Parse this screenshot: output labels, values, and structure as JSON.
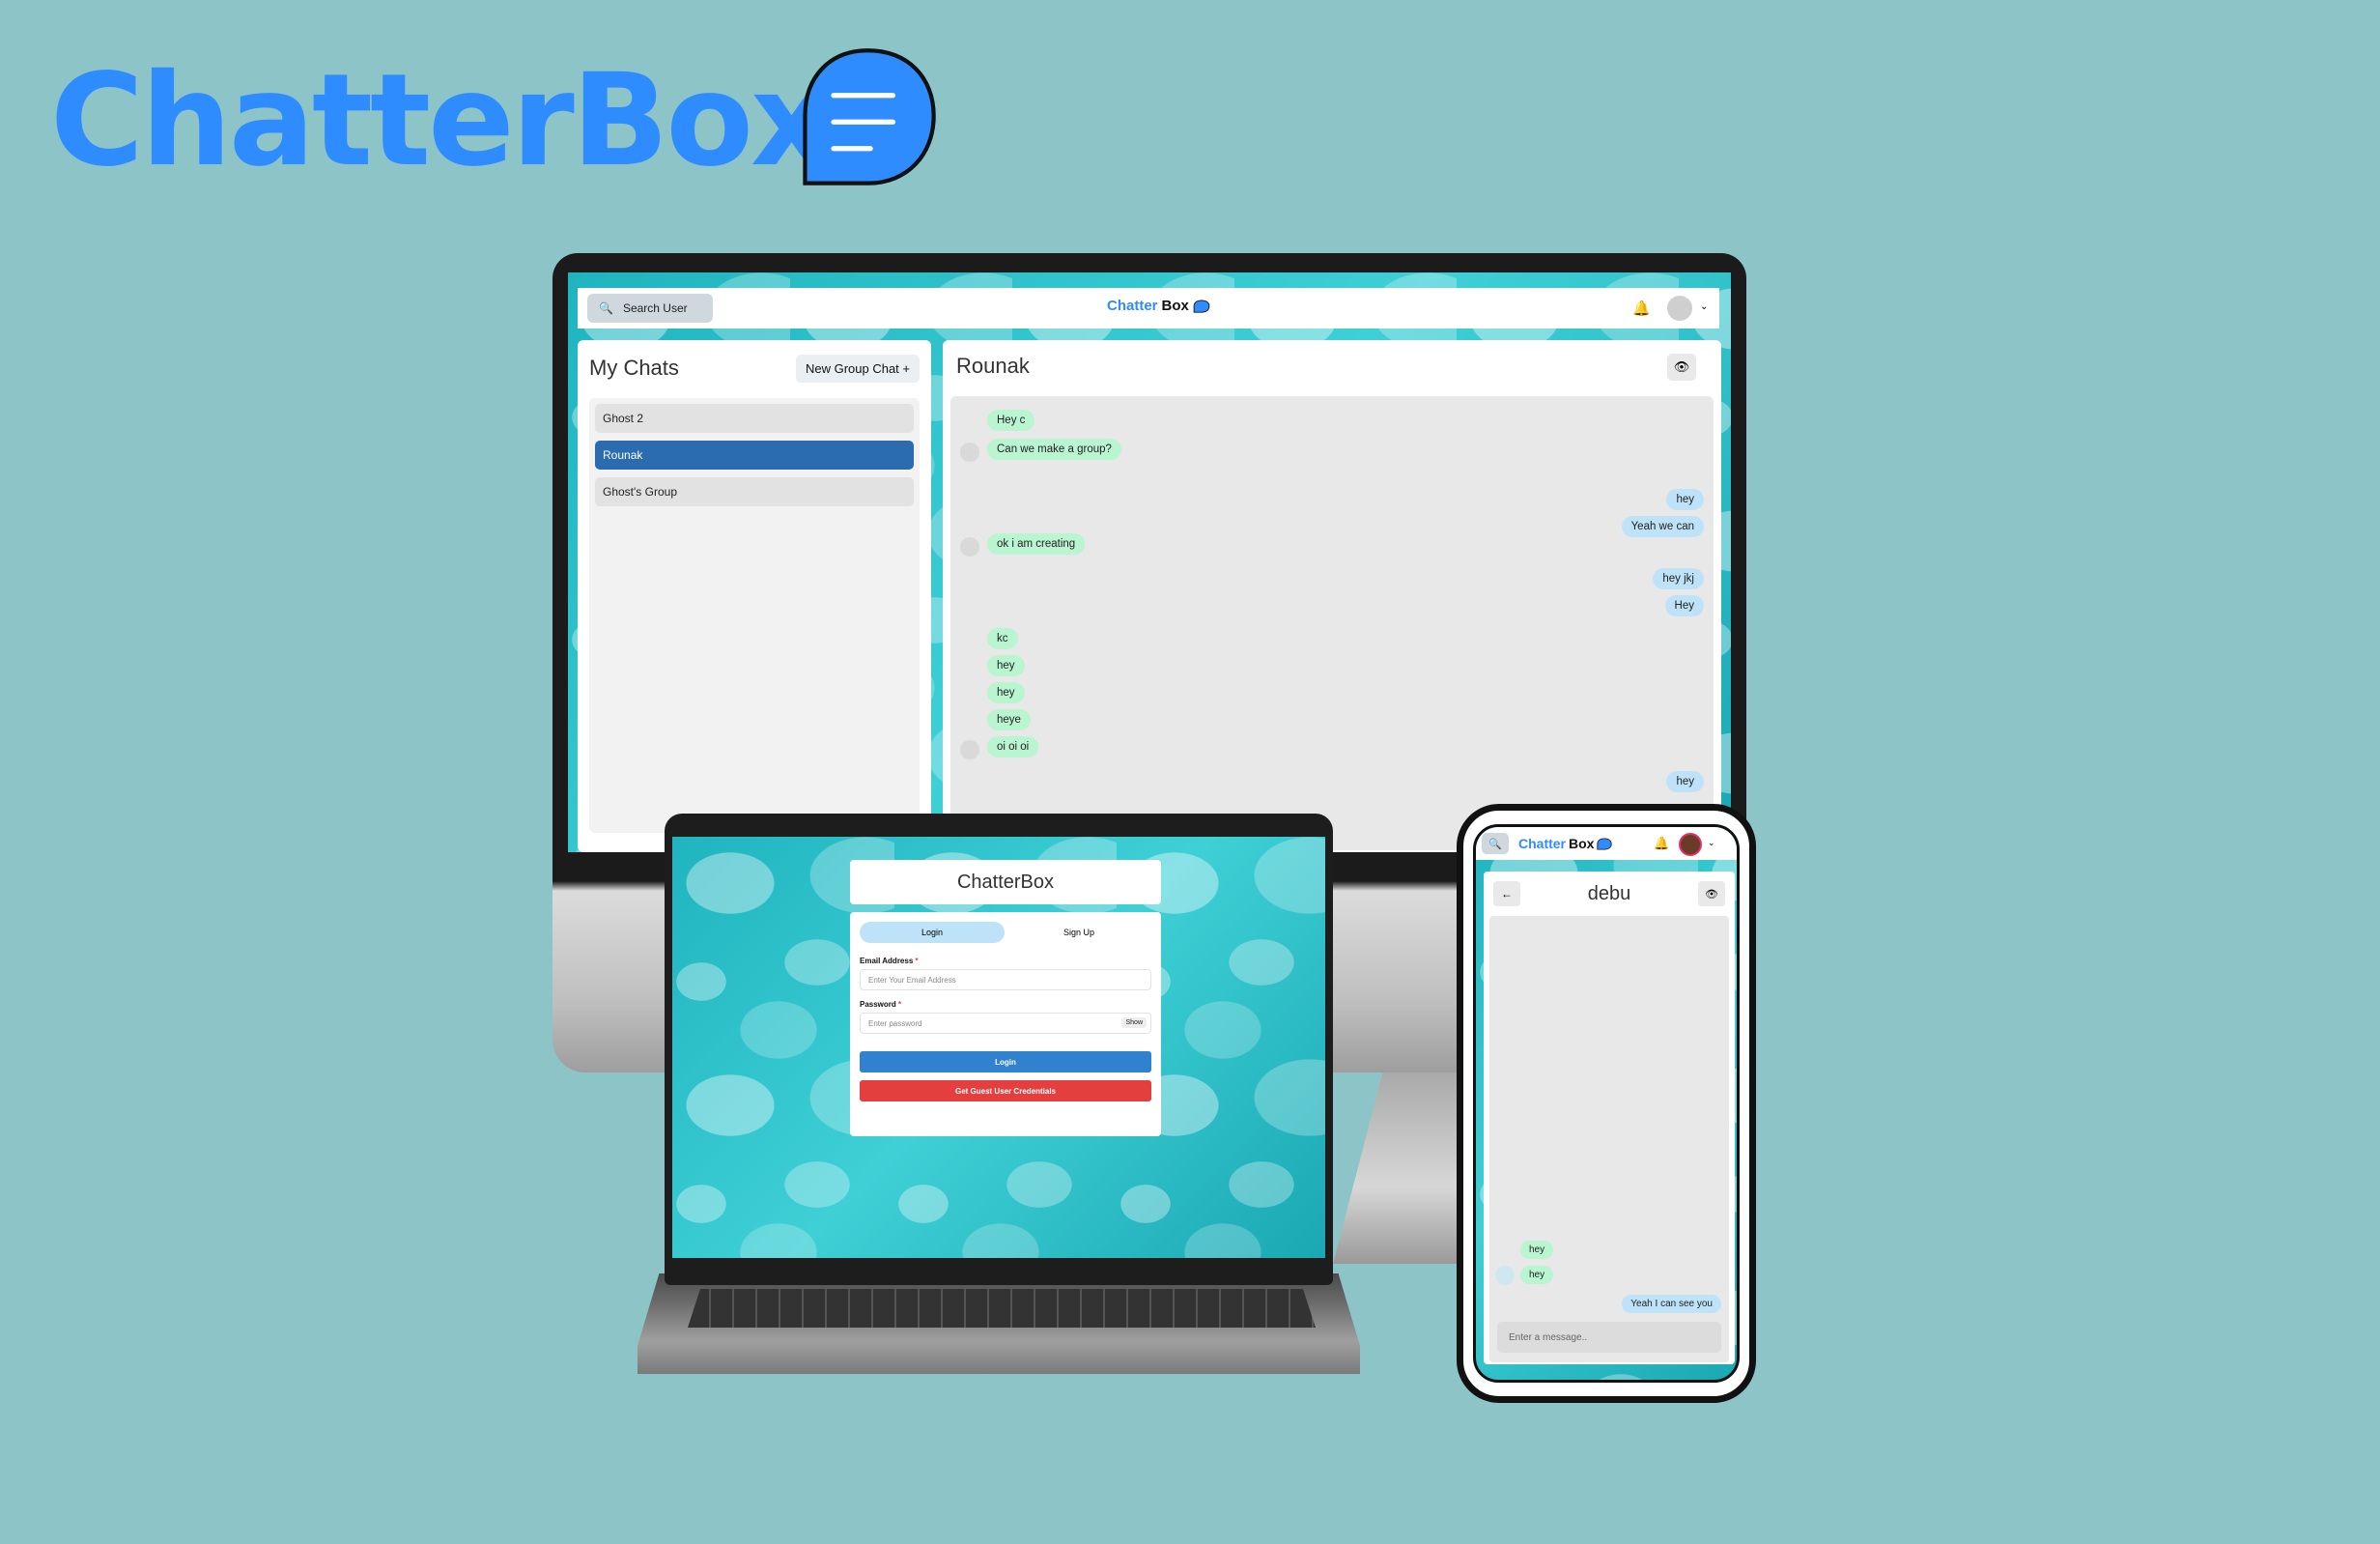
{
  "brand": {
    "title": "ChatterBox",
    "icon": "chat-bubble-lines-icon",
    "color": "#2f8cff"
  },
  "desktop": {
    "search_label": "Search User",
    "logo_prefix": "Chatter",
    "logo_suffix": "Box",
    "my_chats_title": "My Chats",
    "new_group_label": "New Group Chat +",
    "chats": [
      "Ghost 2",
      "Rounak",
      "Ghost's Group"
    ],
    "active_chat": "Rounak",
    "conversation_title": "Rounak",
    "messages": [
      {
        "text": "Hey c",
        "from": "them"
      },
      {
        "text": "Can we make a group?",
        "from": "them"
      },
      {
        "text": "hey",
        "from": "me"
      },
      {
        "text": "Yeah we can",
        "from": "me"
      },
      {
        "text": "ok i am creating",
        "from": "them"
      },
      {
        "text": "hey jkj",
        "from": "me"
      },
      {
        "text": "Hey",
        "from": "me"
      },
      {
        "text": "kc",
        "from": "them"
      },
      {
        "text": "hey",
        "from": "them"
      },
      {
        "text": "hey",
        "from": "them"
      },
      {
        "text": "heye",
        "from": "them"
      },
      {
        "text": "oi oi oi",
        "from": "them"
      },
      {
        "text": "hey",
        "from": "me"
      }
    ]
  },
  "laptop": {
    "title": "ChatterBox",
    "tab_login": "Login",
    "tab_signup": "Sign Up",
    "email_label": "Email Address",
    "email_placeholder": "Enter Your Email Address",
    "password_label": "Password",
    "password_placeholder": "Enter password",
    "show_label": "Show",
    "login_button": "Login",
    "guest_button": "Get Guest User Credentials",
    "required_mark": "*"
  },
  "phone": {
    "logo_prefix": "Chatter",
    "logo_suffix": "Box",
    "chat_title": "debu",
    "messages": [
      {
        "text": "hey",
        "from": "them"
      },
      {
        "text": "hey",
        "from": "them"
      },
      {
        "text": "Yeah I can see you",
        "from": "me"
      }
    ],
    "input_placeholder": "Enter a message.."
  }
}
